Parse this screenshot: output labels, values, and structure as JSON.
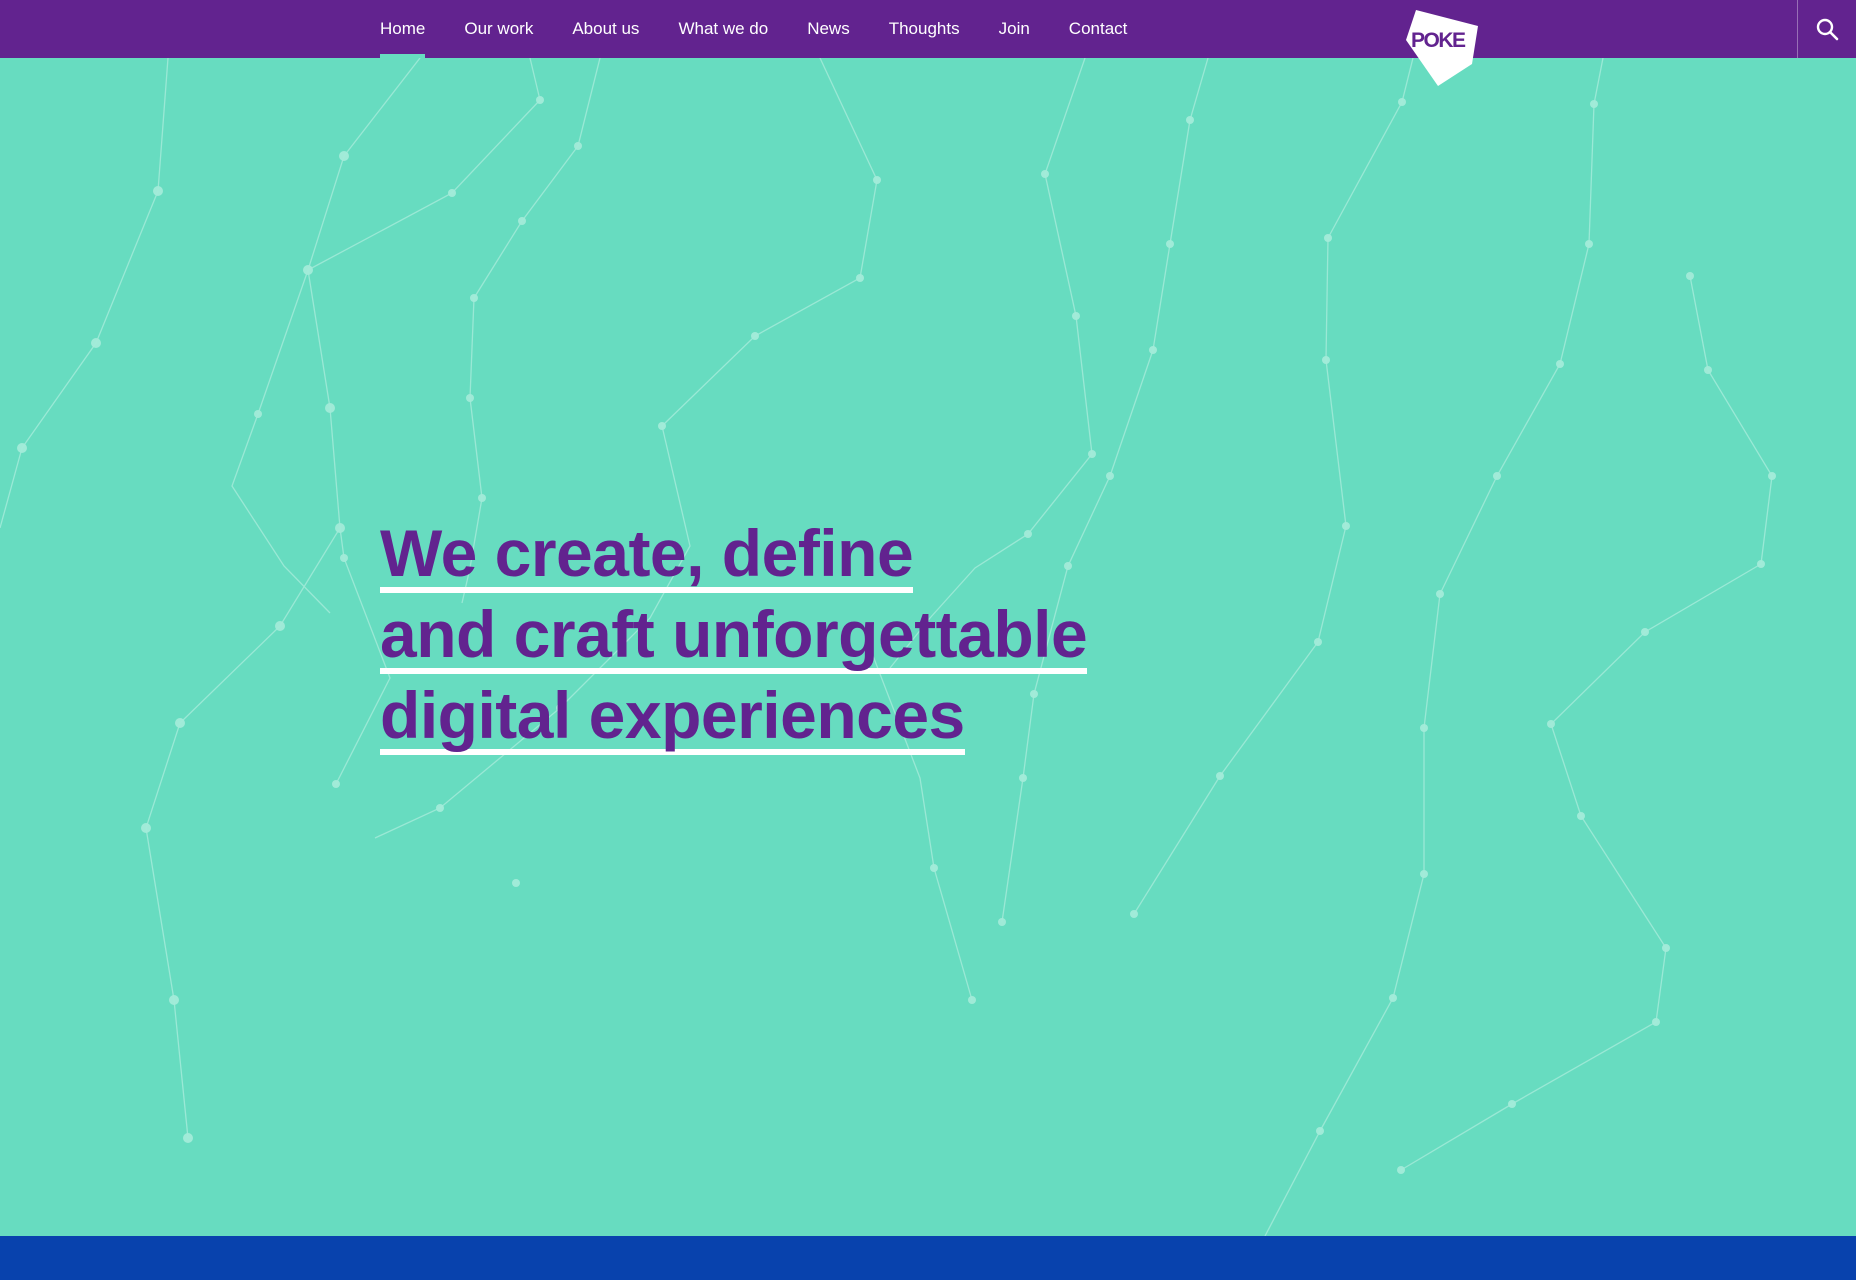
{
  "nav": {
    "items": [
      {
        "label": "Home",
        "active": true
      },
      {
        "label": "Our work",
        "active": false
      },
      {
        "label": "About us",
        "active": false
      },
      {
        "label": "What we do",
        "active": false
      },
      {
        "label": "News",
        "active": false
      },
      {
        "label": "Thoughts",
        "active": false
      },
      {
        "label": "Join",
        "active": false
      },
      {
        "label": "Contact",
        "active": false
      }
    ]
  },
  "logo": {
    "text": "POKE"
  },
  "search": {
    "icon": "search-icon"
  },
  "hero": {
    "lines": [
      "We create, define",
      "and craft unforgettable",
      "digital experiences"
    ]
  },
  "colors": {
    "nav_bg": "#62238f",
    "page_bg": "#67dcc0",
    "headline": "#62238f",
    "underline": "#ffffff",
    "footer_band": "#0842ad"
  }
}
